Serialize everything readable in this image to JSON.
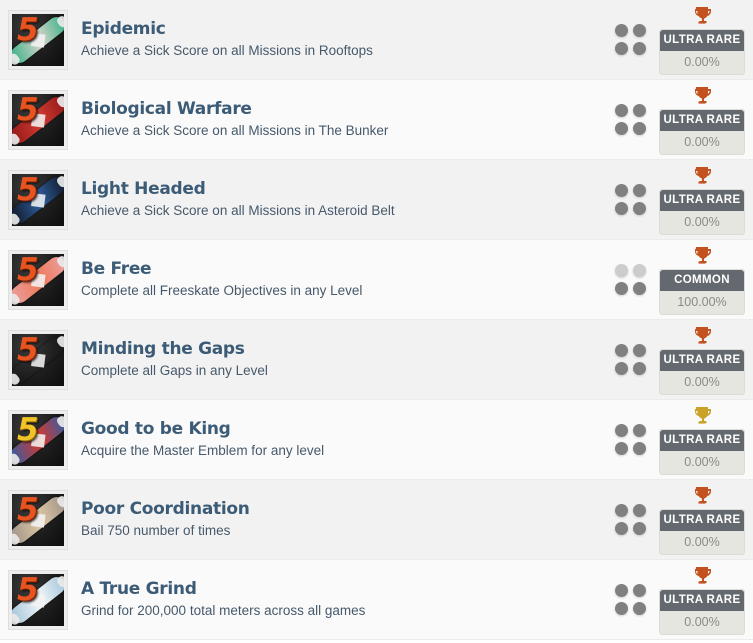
{
  "list": {
    "rows": [
      {
        "title": "Epidemic",
        "description": "Achieve a Sick Score on all Missions in Rooftops",
        "rarity_label": "ULTRA RARE",
        "percent": "0.00%",
        "trophy_icon": "trophy-icon",
        "trophy_color": "#c4521f",
        "deck_color_a": "#2fb083",
        "deck_color_b": "#d8d4cb",
        "logo_color": "orange",
        "dots": [
          "dark",
          "dark",
          "dark",
          "dark"
        ]
      },
      {
        "title": "Biological Warfare",
        "description": "Achieve a Sick Score on all Missions in The Bunker",
        "rarity_label": "ULTRA RARE",
        "percent": "0.00%",
        "trophy_icon": "trophy-icon",
        "trophy_color": "#c4521f",
        "deck_color_a": "#8e1616",
        "deck_color_b": "#d23c32",
        "logo_color": "orange",
        "dots": [
          "dark",
          "dark",
          "dark",
          "dark"
        ]
      },
      {
        "title": "Light Headed",
        "description": "Achieve a Sick Score on all Missions in Asteroid Belt",
        "rarity_label": "ULTRA RARE",
        "percent": "0.00%",
        "trophy_icon": "trophy-icon",
        "trophy_color": "#c4521f",
        "deck_color_a": "#10131f",
        "deck_color_b": "#2e5f9e",
        "logo_color": "orange",
        "dots": [
          "dark",
          "dark",
          "dark",
          "dark"
        ]
      },
      {
        "title": "Be Free",
        "description": "Complete all Freeskate Objectives in any Level",
        "rarity_label": "COMMON",
        "percent": "100.00%",
        "trophy_icon": "trophy-icon",
        "trophy_color": "#c4521f",
        "deck_color_a": "#e8a2a0",
        "deck_color_b": "#f0785a",
        "logo_color": "orange",
        "dots": [
          "light",
          "light",
          "dark",
          "dark"
        ]
      },
      {
        "title": "Minding the Gaps",
        "description": "Complete all Gaps in any Level",
        "rarity_label": "ULTRA RARE",
        "percent": "0.00%",
        "trophy_icon": "trophy-icon",
        "trophy_color": "#c4521f",
        "deck_color_a": "#f0c game",
        "deck_color_b": "#d79b10",
        "logo_color": "orange",
        "dots": [
          "dark",
          "dark",
          "dark",
          "dark"
        ]
      },
      {
        "title": "Good to be King",
        "description": "Acquire the Master Emblem for any level",
        "rarity_label": "ULTRA RARE",
        "percent": "0.00%",
        "trophy_icon": "trophy-icon",
        "trophy_color": "#c9a227",
        "deck_color_a": "#2a5fa8",
        "deck_color_b": "#d8372c",
        "logo_color": "gold",
        "dots": [
          "dark",
          "dark",
          "dark",
          "dark"
        ]
      },
      {
        "title": "Poor Coordination",
        "description": "Bail 750 number of times",
        "rarity_label": "ULTRA RARE",
        "percent": "0.00%",
        "trophy_icon": "trophy-icon",
        "trophy_color": "#c4521f",
        "deck_color_a": "#9b9188",
        "deck_color_b": "#e0c7a4",
        "logo_color": "orange",
        "dots": [
          "dark",
          "dark",
          "dark",
          "dark"
        ]
      },
      {
        "title": "A True Grind",
        "description": "Grind for 200,000 total meters across all games",
        "rarity_label": "ULTRA RARE",
        "percent": "0.00%",
        "trophy_icon": "trophy-icon",
        "trophy_color": "#c4521f",
        "deck_color_a": "#9fc3d8",
        "deck_color_b": "#f2f6f8",
        "logo_color": "orange",
        "dots": [
          "dark",
          "dark",
          "dark",
          "dark"
        ]
      }
    ]
  }
}
